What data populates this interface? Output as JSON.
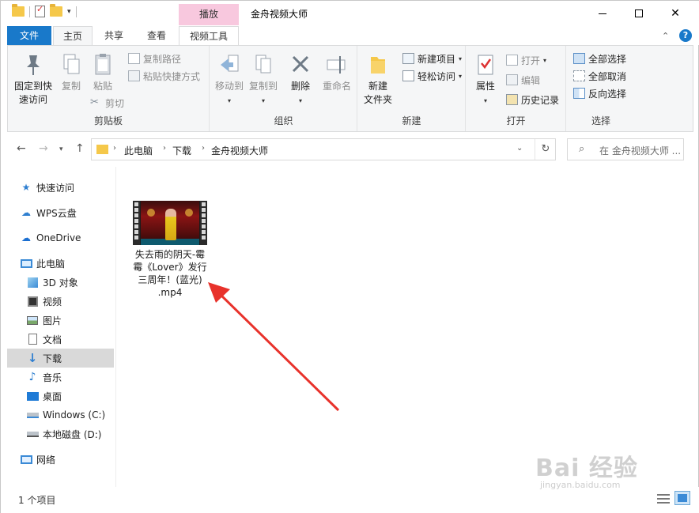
{
  "title_bar": {
    "context_tab_header": "播放",
    "window_title": "金舟视频大师",
    "min_label": "",
    "max_label": "",
    "close_label": "✕"
  },
  "tabs": {
    "file": "文件",
    "home": "主页",
    "share": "共享",
    "view": "查看",
    "video_tools": "视频工具"
  },
  "ribbon": {
    "clipboard": {
      "label": "剪贴板",
      "pin_line1": "固定到快",
      "pin_line2": "速访问",
      "copy": "复制",
      "paste": "粘贴",
      "copy_path": "复制路径",
      "paste_shortcut": "粘贴快捷方式",
      "cut": "剪切"
    },
    "organize": {
      "label": "组织",
      "move_to": "移动到",
      "copy_to": "复制到",
      "delete": "删除",
      "rename": "重命名"
    },
    "new": {
      "label": "新建",
      "new_folder_line1": "新建",
      "new_folder_line2": "文件夹",
      "new_item": "新建项目",
      "easy_access": "轻松访问"
    },
    "open": {
      "label": "打开",
      "properties": "属性",
      "open": "打开",
      "edit": "编辑",
      "history": "历史记录"
    },
    "select": {
      "label": "选择",
      "select_all": "全部选择",
      "select_none": "全部取消",
      "invert": "反向选择"
    }
  },
  "address": {
    "crumbs": [
      "此电脑",
      "下载",
      "金舟视频大师"
    ],
    "search_placeholder": "在 金舟视频大师 ..."
  },
  "sidebar": {
    "items": [
      {
        "label": "快速访问",
        "icon": "star-icon"
      },
      {
        "label": "WPS云盘",
        "icon": "cloud-icon"
      },
      {
        "label": "OneDrive",
        "icon": "onedrive-icon"
      },
      {
        "label": "此电脑",
        "icon": "computer-icon"
      },
      {
        "label": "3D 对象",
        "icon": "cube-icon"
      },
      {
        "label": "视频",
        "icon": "video-icon"
      },
      {
        "label": "图片",
        "icon": "picture-icon"
      },
      {
        "label": "文档",
        "icon": "document-icon"
      },
      {
        "label": "下载",
        "icon": "download-icon"
      },
      {
        "label": "音乐",
        "icon": "music-icon"
      },
      {
        "label": "桌面",
        "icon": "desktop-icon"
      },
      {
        "label": "Windows (C:)",
        "icon": "drive-icon"
      },
      {
        "label": "本地磁盘 (D:)",
        "icon": "drive-icon"
      },
      {
        "label": "网络",
        "icon": "network-icon"
      }
    ]
  },
  "content": {
    "file_name": "失去雨的阴天-霉\n霉《Lover》发行\n三周年！(蓝光)\n.mp4"
  },
  "status": {
    "item_count": "1 个项目"
  },
  "watermark": {
    "main": "Bai 经验",
    "sub": "jingyan.baidu.com"
  },
  "colors": {
    "accent": "#1979ca",
    "context_tab": "#f8c8de",
    "arrow": "#e8322b",
    "selected_nav": "#d9d9d9"
  }
}
